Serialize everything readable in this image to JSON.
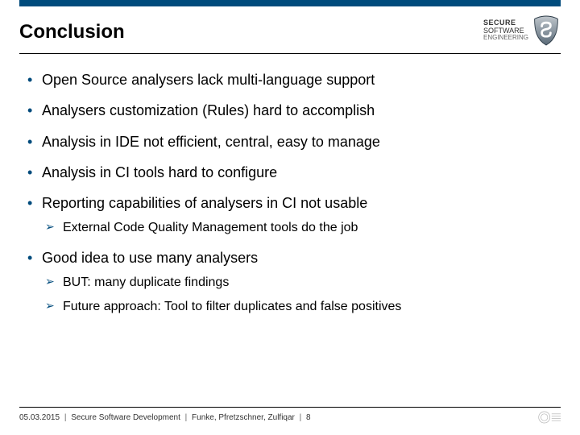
{
  "header": {
    "title": "Conclusion",
    "logo": {
      "line1": "SECURE",
      "line2": "SOFTWARE",
      "line3": "ENGINEERING"
    }
  },
  "bullets": [
    {
      "text": "Open Source analysers lack multi-language support",
      "sub": []
    },
    {
      "text": "Analysers customization (Rules) hard to accomplish",
      "sub": []
    },
    {
      "text": "Analysis in IDE not efficient, central, easy to manage",
      "sub": []
    },
    {
      "text": "Analysis in CI tools hard to configure",
      "sub": []
    },
    {
      "text": "Reporting capabilities of analysers in CI not usable",
      "sub": [
        "External Code Quality Management tools do the job"
      ]
    },
    {
      "text": "Good idea to use many analysers",
      "sub": [
        "BUT: many duplicate findings",
        "Future approach: Tool to filter duplicates and false positives"
      ]
    }
  ],
  "footer": {
    "date": "05.03.2015",
    "course": "Secure Software Development",
    "authors": "Funke, Pfretzschner, Zulfiqar",
    "page": "8"
  }
}
